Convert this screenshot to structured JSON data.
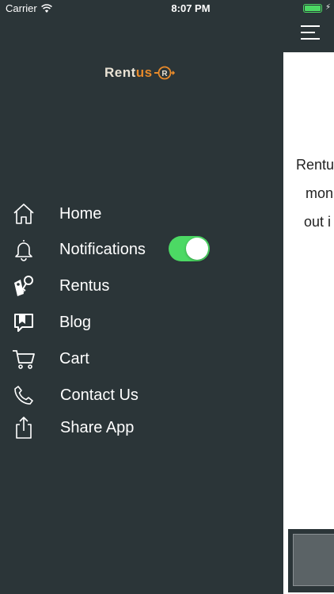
{
  "status_bar": {
    "carrier": "Carrier",
    "time": "8:07 PM"
  },
  "logo": {
    "text_a": "Rent",
    "text_b": "us",
    "brand_colors": {
      "light": "#e9e2d4",
      "accent": "#e88a2a"
    }
  },
  "menu": {
    "items": [
      {
        "label": "Home",
        "icon": "home-icon"
      },
      {
        "label": "Notifications",
        "icon": "bell-icon",
        "toggle_on": true
      },
      {
        "label": "Rentus",
        "icon": "keys-icon"
      },
      {
        "label": "Blog",
        "icon": "blog-icon"
      },
      {
        "label": "Cart",
        "icon": "cart-icon"
      },
      {
        "label": "Contact Us",
        "icon": "phone-icon"
      },
      {
        "label": "Share App",
        "icon": "share-icon"
      }
    ]
  },
  "content": {
    "lines": [
      "Rentu",
      "mon",
      "out i"
    ]
  },
  "colors": {
    "drawer_bg": "#2b3538",
    "toggle_on": "#4cd964",
    "battery": "#4cd964"
  }
}
